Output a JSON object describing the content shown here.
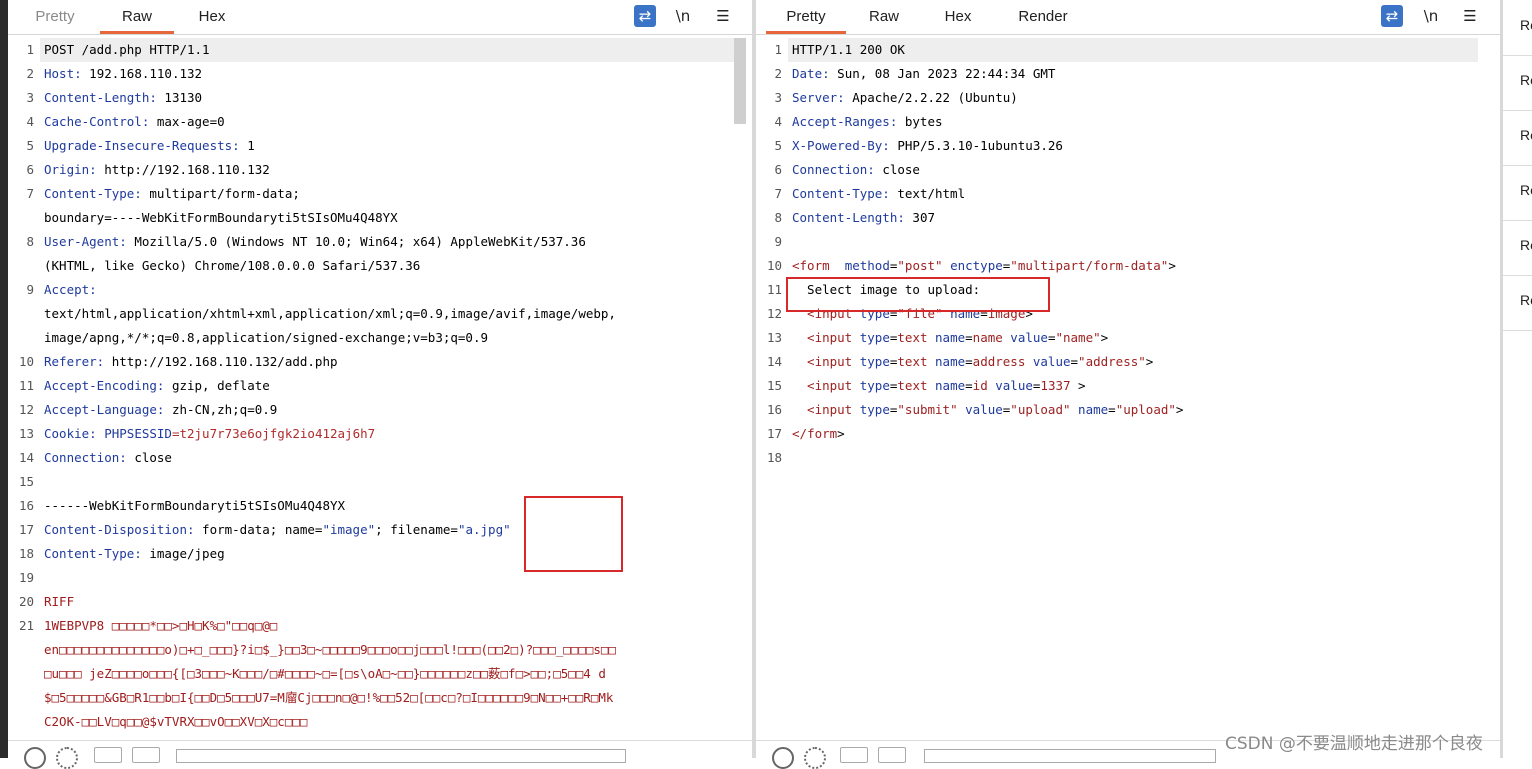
{
  "request": {
    "tabs": [
      {
        "label": "Pretty"
      },
      {
        "label": "Raw"
      },
      {
        "label": "Hex"
      }
    ],
    "active_tab": "Raw",
    "toolbar": {
      "wrap_icon": "wrap-lines-icon",
      "newline_label": "\\n",
      "menu_icon": "hamburger-menu-icon"
    },
    "lines": [
      {
        "n": "1",
        "parts": [
          [
            "POST /add.php HTTP/1.1",
            ""
          ]
        ]
      },
      {
        "n": "2",
        "parts": [
          [
            "Host:",
            "k"
          ],
          [
            " 192.168.110.132",
            ""
          ]
        ]
      },
      {
        "n": "3",
        "parts": [
          [
            "Content-Length:",
            "k"
          ],
          [
            " 13130",
            ""
          ]
        ]
      },
      {
        "n": "4",
        "parts": [
          [
            "Cache-Control:",
            "k"
          ],
          [
            " max-age=0",
            ""
          ]
        ]
      },
      {
        "n": "5",
        "parts": [
          [
            "Upgrade-Insecure-Requests:",
            "k"
          ],
          [
            " 1",
            ""
          ]
        ]
      },
      {
        "n": "6",
        "parts": [
          [
            "Origin:",
            "k"
          ],
          [
            " http://192.168.110.132",
            ""
          ]
        ]
      },
      {
        "n": "7",
        "parts": [
          [
            "Content-Type:",
            "k"
          ],
          [
            " multipart/form-data;",
            ""
          ]
        ]
      },
      {
        "n": "",
        "parts": [
          [
            "boundary=----WebKitFormBoundaryti5tSIsOMu4Q48YX",
            ""
          ]
        ]
      },
      {
        "n": "8",
        "parts": [
          [
            "User-Agent:",
            "k"
          ],
          [
            " Mozilla/5.0 (Windows NT 10.0; Win64; x64) AppleWebKit/537.36",
            ""
          ]
        ]
      },
      {
        "n": "",
        "parts": [
          [
            "(KHTML, like Gecko) Chrome/108.0.0.0 Safari/537.36",
            ""
          ]
        ]
      },
      {
        "n": "9",
        "parts": [
          [
            "Accept:",
            "k"
          ]
        ]
      },
      {
        "n": "",
        "parts": [
          [
            "text/html,application/xhtml+xml,application/xml;q=0.9,image/avif,image/webp,",
            ""
          ]
        ]
      },
      {
        "n": "",
        "parts": [
          [
            "image/apng,*/*;q=0.8,application/signed-exchange;v=b3;q=0.9",
            ""
          ]
        ]
      },
      {
        "n": "10",
        "parts": [
          [
            "Referer:",
            "k"
          ],
          [
            " http://192.168.110.132/add.php",
            ""
          ]
        ]
      },
      {
        "n": "11",
        "parts": [
          [
            "Accept-Encoding:",
            "k"
          ],
          [
            " gzip, deflate",
            ""
          ]
        ]
      },
      {
        "n": "12",
        "parts": [
          [
            "Accept-Language:",
            "k"
          ],
          [
            " zh-CN,zh;q=0.9",
            ""
          ]
        ]
      },
      {
        "n": "13",
        "parts": [
          [
            "Cookie:",
            "k"
          ],
          [
            " ",
            ""
          ],
          [
            "PHPSESSID",
            "k"
          ],
          [
            "=t2ju7r73e6ojfgk2io412aj6h7",
            "cookiev"
          ]
        ]
      },
      {
        "n": "14",
        "parts": [
          [
            "Connection:",
            "k"
          ],
          [
            " close",
            ""
          ]
        ]
      },
      {
        "n": "15",
        "parts": [
          [
            "",
            ""
          ]
        ]
      },
      {
        "n": "16",
        "parts": [
          [
            "------WebKitFormBoundaryti5tSIsOMu4Q48YX",
            ""
          ]
        ]
      },
      {
        "n": "17",
        "parts": [
          [
            "Content-Disposition:",
            "k"
          ],
          [
            " form-data; name=",
            ""
          ],
          [
            "\"image\"",
            "s"
          ],
          [
            "; filename=",
            ""
          ],
          [
            "\"a.jpg\"",
            "s"
          ]
        ]
      },
      {
        "n": "18",
        "parts": [
          [
            "Content-Type:",
            "k"
          ],
          [
            " image/jpeg",
            ""
          ]
        ]
      },
      {
        "n": "19",
        "parts": [
          [
            "",
            ""
          ]
        ]
      },
      {
        "n": "20",
        "parts": [
          [
            "RIFF",
            "raw"
          ]
        ]
      },
      {
        "n": "21",
        "parts": [
          [
            "1WEBPVP8 □□□□□*□□>□H□K%□\"□□q□@□",
            "raw"
          ]
        ]
      },
      {
        "n": "",
        "parts": [
          [
            "en□□□□□□□□□□□□□□o)□+□_□□□}?i□$_}□□3□~□□□□□9□□□o□□j□□□l!□□□(□□2□)?□□□_□□□□s□□",
            "raw"
          ]
        ]
      },
      {
        "n": "",
        "parts": [
          [
            "□u□□□ jeZ□□□□o□□□{[□3□□□~K□□□/□#□□□□~□=[□s\\oA□~□□}□□□□□□z□□薮□f□>□□;□5□□4 d",
            "raw"
          ]
        ]
      },
      {
        "n": "",
        "parts": [
          [
            "$□5□□□□□&GB□R1□□b□I{□□D□5□□□U7=M廇Cj□□□n□@□!%□□52□[□□c□?□I□□□□□□9□N□□+□□R□Mk",
            "raw"
          ]
        ]
      },
      {
        "n": "",
        "parts": [
          [
            "C2OK-□□LV□q□□@$vTVRX□□vO□□XV□X□c□□□",
            "raw"
          ]
        ]
      }
    ]
  },
  "response": {
    "tabs": [
      {
        "label": "Pretty"
      },
      {
        "label": "Raw"
      },
      {
        "label": "Hex"
      },
      {
        "label": "Render"
      }
    ],
    "active_tab": "Pretty",
    "toolbar": {
      "wrap_icon": "wrap-lines-icon",
      "newline_label": "\\n",
      "menu_icon": "hamburger-menu-icon"
    },
    "lines": [
      {
        "n": "1",
        "parts": [
          [
            "HTTP/1.1 200 OK",
            ""
          ]
        ]
      },
      {
        "n": "2",
        "parts": [
          [
            "Date:",
            "k"
          ],
          [
            " Sun, 08 Jan 2023 22:44:34 GMT",
            ""
          ]
        ]
      },
      {
        "n": "3",
        "parts": [
          [
            "Server:",
            "k"
          ],
          [
            " Apache/2.2.22 (Ubuntu)",
            ""
          ]
        ]
      },
      {
        "n": "4",
        "parts": [
          [
            "Accept-Ranges:",
            "k"
          ],
          [
            " bytes",
            ""
          ]
        ]
      },
      {
        "n": "5",
        "parts": [
          [
            "X-Powered-By:",
            "k"
          ],
          [
            " PHP/5.3.10-1ubuntu3.26",
            ""
          ]
        ]
      },
      {
        "n": "6",
        "parts": [
          [
            "Connection:",
            "k"
          ],
          [
            " close",
            ""
          ]
        ]
      },
      {
        "n": "7",
        "parts": [
          [
            "Content-Type:",
            "k"
          ],
          [
            " text/html",
            ""
          ]
        ]
      },
      {
        "n": "8",
        "parts": [
          [
            "Content-Length:",
            "k"
          ],
          [
            " 307",
            ""
          ]
        ]
      },
      {
        "n": "9",
        "parts": [
          [
            "",
            ""
          ]
        ]
      },
      {
        "n": "10",
        "parts": [
          [
            "<",
            "t"
          ],
          [
            "form",
            "t"
          ],
          [
            "  method",
            "a"
          ],
          [
            "=",
            ""
          ],
          [
            "\"post\"",
            "t"
          ],
          [
            " enctype",
            "a"
          ],
          [
            "=",
            ""
          ],
          [
            "\"multipart/form-data\"",
            "t"
          ],
          [
            ">",
            ""
          ]
        ]
      },
      {
        "n": "11",
        "parts": [
          [
            "  Select image to upload:",
            ""
          ]
        ]
      },
      {
        "n": "12",
        "parts": [
          [
            "  <",
            "t"
          ],
          [
            "input",
            "t"
          ],
          [
            " type",
            "a"
          ],
          [
            "=",
            ""
          ],
          [
            "\"file\"",
            "t"
          ],
          [
            " name",
            "a"
          ],
          [
            "=",
            ""
          ],
          [
            "image",
            "t"
          ],
          [
            ">",
            ""
          ]
        ]
      },
      {
        "n": "13",
        "parts": [
          [
            "  <",
            "t"
          ],
          [
            "input",
            "t"
          ],
          [
            " type",
            "a"
          ],
          [
            "=",
            ""
          ],
          [
            "text",
            "t"
          ],
          [
            " name",
            "a"
          ],
          [
            "=",
            ""
          ],
          [
            "name",
            "t"
          ],
          [
            " value",
            "a"
          ],
          [
            "=",
            ""
          ],
          [
            "\"name\"",
            "t"
          ],
          [
            ">",
            ""
          ]
        ]
      },
      {
        "n": "14",
        "parts": [
          [
            "  <",
            "t"
          ],
          [
            "input",
            "t"
          ],
          [
            " type",
            "a"
          ],
          [
            "=",
            ""
          ],
          [
            "text",
            "t"
          ],
          [
            " name",
            "a"
          ],
          [
            "=",
            ""
          ],
          [
            "address",
            "t"
          ],
          [
            " value",
            "a"
          ],
          [
            "=",
            ""
          ],
          [
            "\"address\"",
            "t"
          ],
          [
            ">",
            ""
          ]
        ]
      },
      {
        "n": "15",
        "parts": [
          [
            "  <",
            "t"
          ],
          [
            "input",
            "t"
          ],
          [
            " type",
            "a"
          ],
          [
            "=",
            ""
          ],
          [
            "text",
            "t"
          ],
          [
            " name",
            "a"
          ],
          [
            "=",
            ""
          ],
          [
            "id",
            "t"
          ],
          [
            " value",
            "a"
          ],
          [
            "=",
            ""
          ],
          [
            "1337",
            "t"
          ],
          [
            " >",
            ""
          ]
        ]
      },
      {
        "n": "16",
        "parts": [
          [
            "  <",
            "t"
          ],
          [
            "input",
            "t"
          ],
          [
            " type",
            "a"
          ],
          [
            "=",
            ""
          ],
          [
            "\"submit\"",
            "t"
          ],
          [
            " value",
            "a"
          ],
          [
            "=",
            ""
          ],
          [
            "\"upload\"",
            "t"
          ],
          [
            " name",
            "a"
          ],
          [
            "=",
            ""
          ],
          [
            "\"upload\"",
            "t"
          ],
          [
            ">",
            ""
          ]
        ]
      },
      {
        "n": "17",
        "parts": [
          [
            "</",
            "t"
          ],
          [
            "form",
            "t"
          ],
          [
            ">",
            ""
          ]
        ]
      },
      {
        "n": "18",
        "parts": [
          [
            "",
            ""
          ]
        ]
      }
    ]
  },
  "side_panel": {
    "items": [
      {
        "label": "Re"
      },
      {
        "label": "Re"
      },
      {
        "label": "Re"
      },
      {
        "label": "Re"
      },
      {
        "label": "Re"
      },
      {
        "label": "Re"
      }
    ]
  },
  "watermark": "CSDN @不要温顺地走进那个良夜",
  "colors": {
    "accent_tab": "#e8673a",
    "highlight_box": "#d7282a",
    "header_key": "#1f3a9e"
  }
}
